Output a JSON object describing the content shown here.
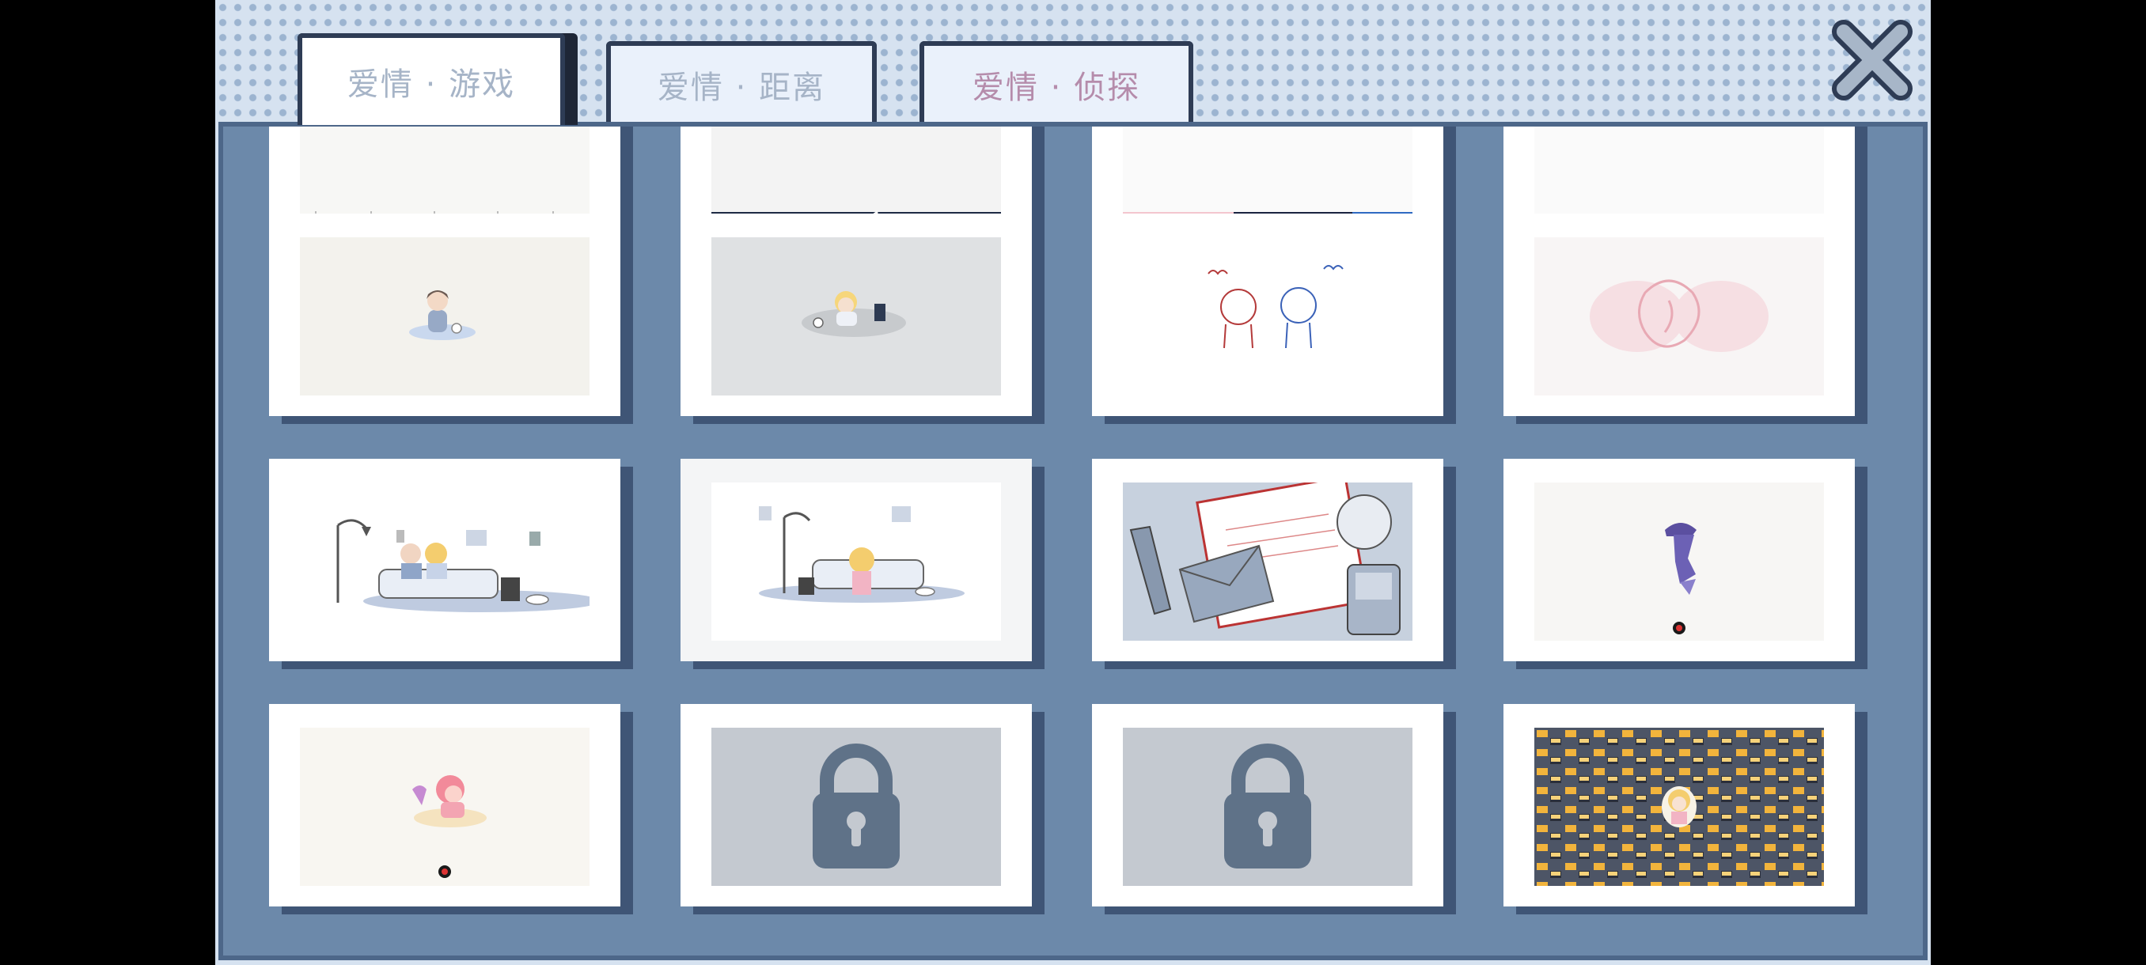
{
  "tabs": [
    {
      "label": "爱情 · 游戏",
      "active": true
    },
    {
      "label": "爱情 · 距离",
      "active": false
    },
    {
      "label": "爱情 · 侦探",
      "active": false
    }
  ],
  "close_icon": "close-x-icon",
  "gallery": {
    "rows": [
      [
        "partial-top",
        "partial-top-dark",
        "partial-top-pink",
        "partial-top"
      ],
      [
        "boy-with-cat",
        "girl-with-console",
        "couple-sketch-red-blue",
        "pink-embrace-sketch"
      ],
      [
        "couple-on-sofa",
        "girl-on-sofa",
        "letter-and-gameboy",
        "purple-figure"
      ],
      [
        "pink-girl-with-lamp",
        "locked",
        "locked",
        "game-pattern"
      ]
    ],
    "lock_icon": "lock-icon",
    "colors": {
      "panel": "#6c89aa",
      "shadow": "#3f5576",
      "lock_bg": "#c4c9d0",
      "lock": "#5f7288"
    }
  }
}
